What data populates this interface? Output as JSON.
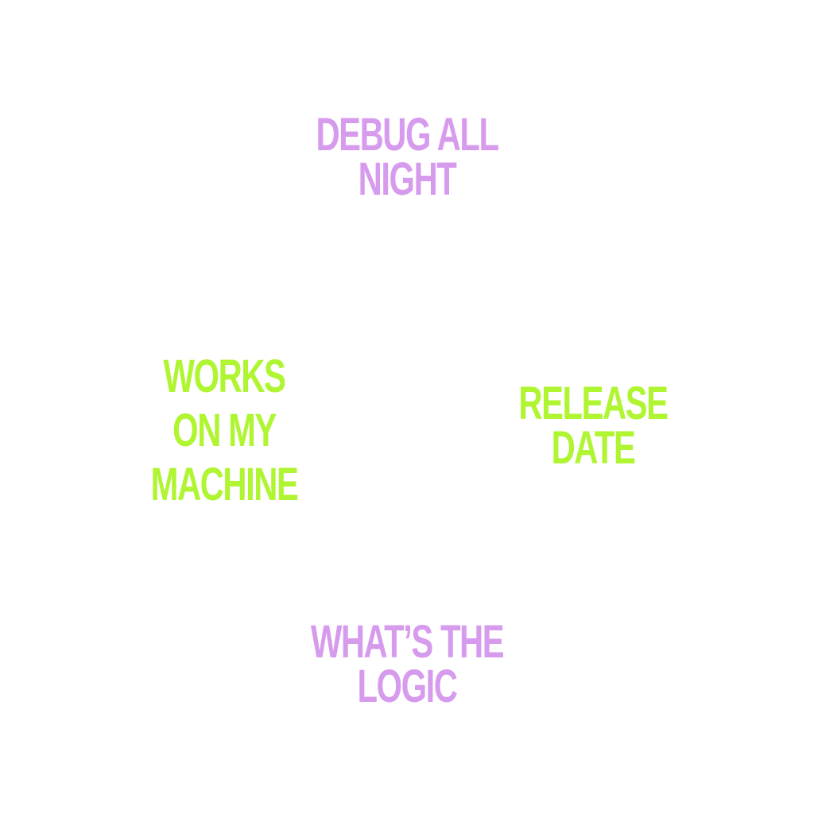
{
  "colors": {
    "background": "#ffffff",
    "purple": "#d79bee",
    "green": "#aff531"
  },
  "phrases": {
    "top": {
      "line1": "DEBUG ALL",
      "line2": "NIGHT"
    },
    "left": {
      "line1": "WORKS",
      "line2": "ON MY",
      "line3": "MACHINE"
    },
    "right": {
      "line1": "RELEASE",
      "line2": "DATE"
    },
    "bottom": {
      "line1": "WHAT’S THE",
      "line2": "LOGIC"
    }
  }
}
